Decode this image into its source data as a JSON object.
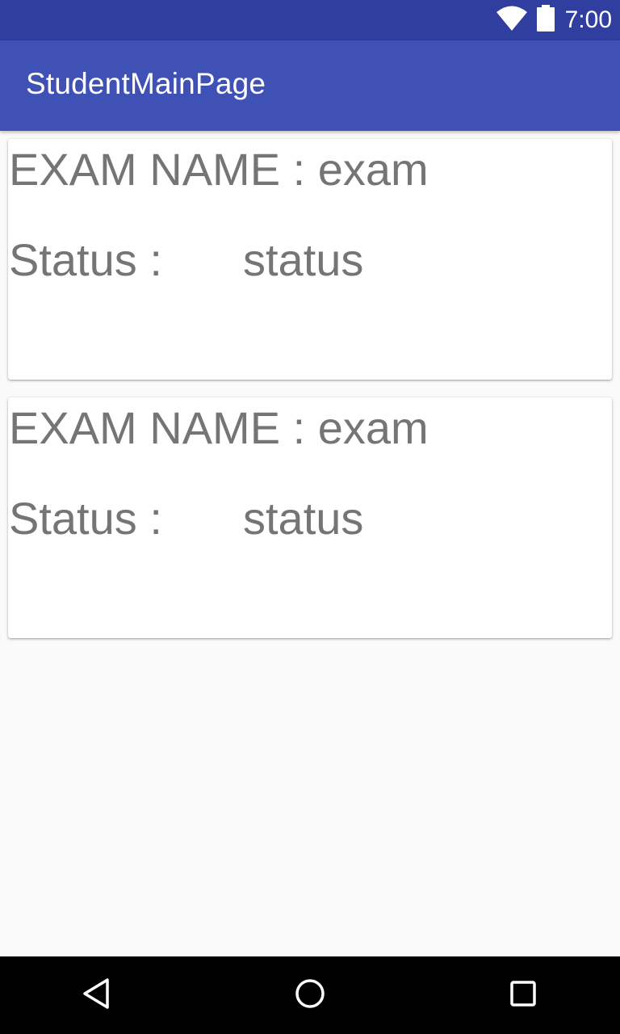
{
  "status_bar": {
    "time": "7:00",
    "icons": [
      "wifi-icon",
      "battery-icon"
    ]
  },
  "app_bar": {
    "title": "StudentMainPage"
  },
  "exams": [
    {
      "exam_name_line": "EXAM NAME : exam",
      "status_label": "Status :",
      "status_value": "status"
    },
    {
      "exam_name_line": "EXAM NAME : exam",
      "status_label": "Status :",
      "status_value": "status"
    }
  ],
  "nav_bar": {
    "icons": [
      "back-icon",
      "home-icon",
      "recents-icon"
    ]
  },
  "colors": {
    "status_bar": "#303f9f",
    "app_bar": "#3f51b5",
    "background": "#fafafa",
    "card_text": "#757575",
    "nav_bar": "#000000"
  }
}
